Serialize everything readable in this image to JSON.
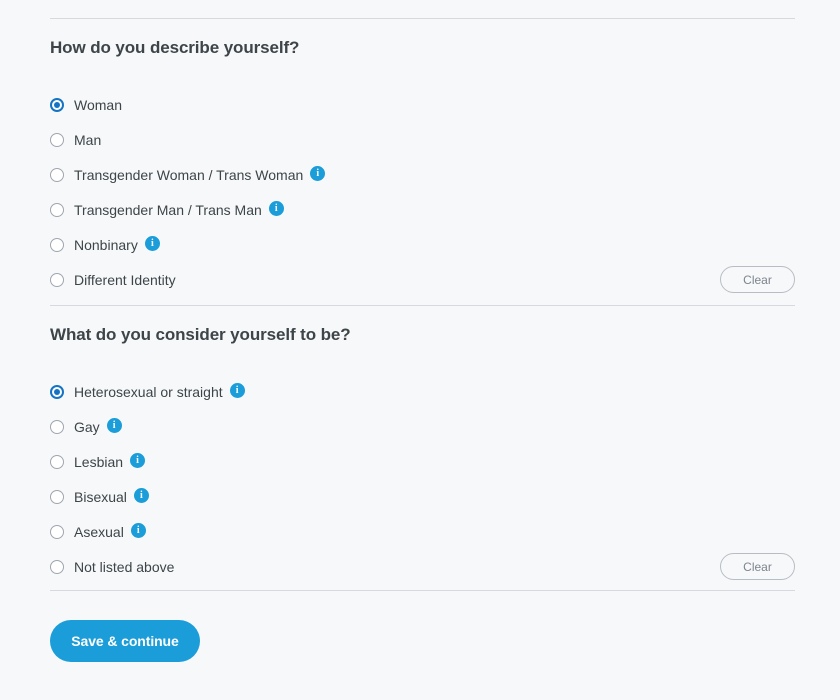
{
  "theme": {
    "background": "#f7f8fa",
    "accent": "#1b9dd9",
    "radio_selected": "#1573c6",
    "text": "#3d4548",
    "divider": "#d6d9de",
    "clear_border": "#b8bdc4",
    "clear_text": "#7d848c"
  },
  "sections": [
    {
      "heading": "How do you describe yourself?",
      "clear_label": "Clear",
      "options": [
        {
          "label": "Woman",
          "selected": true,
          "info": false,
          "info_icon": "info-icon"
        },
        {
          "label": "Man",
          "selected": false,
          "info": false,
          "info_icon": "info-icon"
        },
        {
          "label": "Transgender Woman / Trans Woman",
          "selected": false,
          "info": true,
          "info_icon": "info-icon"
        },
        {
          "label": "Transgender Man / Trans Man",
          "selected": false,
          "info": true,
          "info_icon": "info-icon"
        },
        {
          "label": "Nonbinary",
          "selected": false,
          "info": true,
          "info_icon": "info-icon"
        },
        {
          "label": "Different Identity",
          "selected": false,
          "info": false,
          "info_icon": "info-icon"
        }
      ]
    },
    {
      "heading": "What do you consider yourself to be?",
      "clear_label": "Clear",
      "options": [
        {
          "label": "Heterosexual or straight",
          "selected": true,
          "info": true,
          "info_icon": "info-icon"
        },
        {
          "label": "Gay",
          "selected": false,
          "info": true,
          "info_icon": "info-icon"
        },
        {
          "label": "Lesbian",
          "selected": false,
          "info": true,
          "info_icon": "info-icon"
        },
        {
          "label": "Bisexual",
          "selected": false,
          "info": true,
          "info_icon": "info-icon"
        },
        {
          "label": "Asexual",
          "selected": false,
          "info": true,
          "info_icon": "info-icon"
        },
        {
          "label": "Not listed above",
          "selected": false,
          "info": false,
          "info_icon": "info-icon"
        }
      ]
    }
  ],
  "footer": {
    "save_label": "Save & continue"
  },
  "info_glyph": "i"
}
